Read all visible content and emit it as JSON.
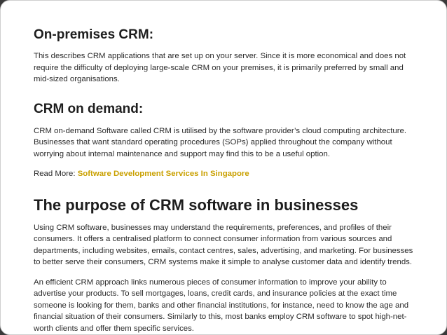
{
  "sections": {
    "on_premises": {
      "heading": "On-premises CRM:",
      "body": "This describes CRM applications that are set up on your server. Since it is more economical and does not require the difficulty of deploying large-scale CRM on your premises, it is primarily preferred by small and mid-sized organisations."
    },
    "on_demand": {
      "heading": "CRM on demand:",
      "body": "CRM on-demand Software called CRM is utilised by the software provider’s cloud computing architecture. Businesses that want standard operating procedures (SOPs) applied throughout the company without worrying about internal maintenance and support may find this to be a useful option."
    },
    "read_more": {
      "prefix": "Read More: ",
      "link_text": "Software Development Services In Singapore"
    },
    "purpose": {
      "heading": "The purpose of CRM software in businesses",
      "paragraph_1": "Using CRM software, businesses may understand the requirements, preferences, and profiles of their consumers. It offers a centralised platform to connect consumer information from various sources and departments, including websites, emails, contact centres, sales, advertising, and marketing. For businesses to better serve their consumers, CRM systems make it simple to analyse customer data and identify trends.",
      "paragraph_2": "An efficient CRM approach links numerous pieces of consumer information to improve your ability to advertise your products. To sell mortgages, loans, credit cards, and insurance policies at the exact time someone is looking for them, banks and other financial institutions, for instance, need to know the age and financial situation of their consumers. Similarly to this, most banks employ CRM software to spot high-net-worth clients and offer them specific services."
    }
  },
  "colors": {
    "link": "#c9a000",
    "text": "#2a2a2a",
    "heading": "#1e1e1e"
  }
}
